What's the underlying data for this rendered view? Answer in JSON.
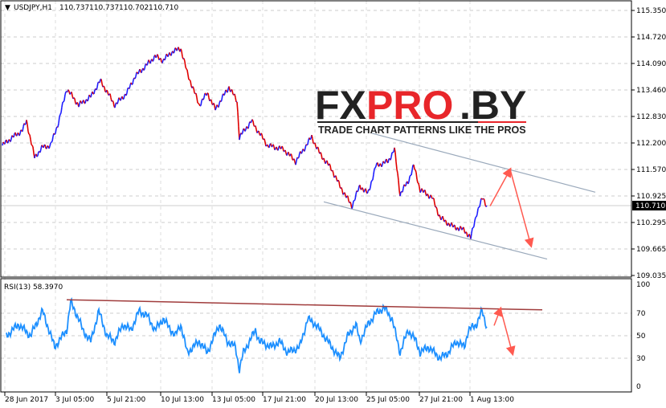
{
  "header": {
    "symbol": "USDJPY,H1",
    "open": "110.737",
    "high": "110.737",
    "low": "110.702",
    "close": "110.710"
  },
  "logo": {
    "part1": "FX",
    "part2": "PRO",
    "part3": ".BY",
    "tagline": "TRADE CHART PATTERNS LIKE THE PROS"
  },
  "colors": {
    "bull": "#1e1eff",
    "bear": "#e00000",
    "rsi": "#1e90ff",
    "trend": "#9aa9bb",
    "arrow": "#ff5a50",
    "rsi_trend": "#a03c3c"
  },
  "chart_data": [
    {
      "type": "line",
      "title": "USDJPY,H1",
      "x_unit": "bar index (H1)",
      "price_ticks": [
        "115.350",
        "114.720",
        "114.090",
        "113.460",
        "112.830",
        "112.200",
        "111.570",
        "110.925",
        "110.295",
        "109.665",
        "109.035"
      ],
      "current_price": "110.710",
      "ylim": [
        109.035,
        115.35
      ],
      "xlim": [
        0,
        780
      ],
      "points": [
        [
          0,
          112.14
        ],
        [
          10,
          112.3
        ],
        [
          25,
          112.5
        ],
        [
          30,
          112.72
        ],
        [
          40,
          111.86
        ],
        [
          50,
          112.1
        ],
        [
          60,
          112.14
        ],
        [
          70,
          112.7
        ],
        [
          80,
          113.49
        ],
        [
          95,
          113.1
        ],
        [
          110,
          113.3
        ],
        [
          122,
          113.68
        ],
        [
          140,
          113.1
        ],
        [
          155,
          113.39
        ],
        [
          165,
          113.78
        ],
        [
          180,
          114.06
        ],
        [
          190,
          114.26
        ],
        [
          200,
          114.16
        ],
        [
          210,
          114.35
        ],
        [
          222,
          114.45
        ],
        [
          230,
          113.87
        ],
        [
          245,
          113.1
        ],
        [
          255,
          113.39
        ],
        [
          265,
          113.0
        ],
        [
          282,
          113.53
        ],
        [
          292,
          113.2
        ],
        [
          295,
          112.34
        ],
        [
          310,
          112.72
        ],
        [
          330,
          112.14
        ],
        [
          350,
          112.05
        ],
        [
          365,
          111.76
        ],
        [
          385,
          112.34
        ],
        [
          395,
          111.95
        ],
        [
          410,
          111.57
        ],
        [
          420,
          111.18
        ],
        [
          435,
          110.7
        ],
        [
          445,
          111.18
        ],
        [
          455,
          110.99
        ],
        [
          465,
          111.66
        ],
        [
          480,
          111.76
        ],
        [
          488,
          112.05
        ],
        [
          495,
          110.99
        ],
        [
          505,
          111.28
        ],
        [
          512,
          111.66
        ],
        [
          520,
          111.09
        ],
        [
          535,
          110.9
        ],
        [
          545,
          110.42
        ],
        [
          560,
          110.22
        ],
        [
          575,
          110.13
        ],
        [
          583,
          109.94
        ],
        [
          590,
          110.51
        ],
        [
          598,
          110.9
        ],
        [
          603,
          110.71
        ]
      ],
      "channel_upper": [
        [
          460,
          112.43
        ],
        [
          738,
          111.03
        ]
      ],
      "channel_lower": [
        [
          400,
          110.8
        ],
        [
          678,
          109.44
        ]
      ],
      "projection_arrows": [
        [
          [
            607,
            110.7
          ],
          [
            632,
            111.57
          ]
        ],
        [
          [
            632,
            111.57
          ],
          [
            658,
            109.76
          ]
        ]
      ]
    },
    {
      "type": "line",
      "title": "RSI(13) 58.3970",
      "ylim": [
        0,
        100
      ],
      "y_ticks": [
        "100",
        "70",
        "50",
        "30",
        "0"
      ],
      "points": [
        [
          5,
          50
        ],
        [
          20,
          60
        ],
        [
          35,
          50
        ],
        [
          50,
          72
        ],
        [
          65,
          40
        ],
        [
          80,
          55
        ],
        [
          85,
          80
        ],
        [
          95,
          65
        ],
        [
          100,
          55
        ],
        [
          110,
          45
        ],
        [
          120,
          72
        ],
        [
          130,
          50
        ],
        [
          140,
          45
        ],
        [
          150,
          60
        ],
        [
          160,
          55
        ],
        [
          170,
          72
        ],
        [
          180,
          68
        ],
        [
          190,
          55
        ],
        [
          200,
          65
        ],
        [
          215,
          50
        ],
        [
          222,
          60
        ],
        [
          230,
          35
        ],
        [
          245,
          45
        ],
        [
          255,
          35
        ],
        [
          270,
          60
        ],
        [
          280,
          45
        ],
        [
          290,
          40
        ],
        [
          295,
          20
        ],
        [
          300,
          35
        ],
        [
          315,
          55
        ],
        [
          320,
          45
        ],
        [
          335,
          40
        ],
        [
          345,
          45
        ],
        [
          355,
          35
        ],
        [
          370,
          40
        ],
        [
          380,
          65
        ],
        [
          390,
          60
        ],
        [
          400,
          50
        ],
        [
          410,
          40
        ],
        [
          420,
          30
        ],
        [
          430,
          50
        ],
        [
          440,
          60
        ],
        [
          445,
          45
        ],
        [
          455,
          60
        ],
        [
          465,
          70
        ],
        [
          475,
          75
        ],
        [
          485,
          65
        ],
        [
          495,
          35
        ],
        [
          505,
          55
        ],
        [
          515,
          45
        ],
        [
          520,
          35
        ],
        [
          530,
          40
        ],
        [
          545,
          30
        ],
        [
          555,
          35
        ],
        [
          565,
          45
        ],
        [
          575,
          40
        ],
        [
          580,
          55
        ],
        [
          590,
          60
        ],
        [
          597,
          72
        ],
        [
          603,
          58
        ]
      ],
      "trendline": [
        [
          80,
          82
        ],
        [
          672,
          73
        ]
      ],
      "projection_arrows": [
        [
          [
            612,
            59
          ],
          [
            620,
            74
          ]
        ],
        [
          [
            620,
            74
          ],
          [
            635,
            34
          ]
        ]
      ]
    }
  ],
  "time_axis": [
    {
      "label": "28 Jun 2017",
      "bar": 3
    },
    {
      "label": "3 Jul 05:00",
      "bar": 66
    },
    {
      "label": "5 Jul 21:00",
      "bar": 130
    },
    {
      "label": "10 Jul 13:00",
      "bar": 197
    },
    {
      "label": "13 Jul 05:00",
      "bar": 261
    },
    {
      "label": "17 Jul 21:00",
      "bar": 324
    },
    {
      "label": "20 Jul 13:00",
      "bar": 389
    },
    {
      "label": "25 Jul 05:00",
      "bar": 453
    },
    {
      "label": "27 Jul 21:00",
      "bar": 519
    },
    {
      "label": "1 Aug 13:00",
      "bar": 582
    }
  ]
}
